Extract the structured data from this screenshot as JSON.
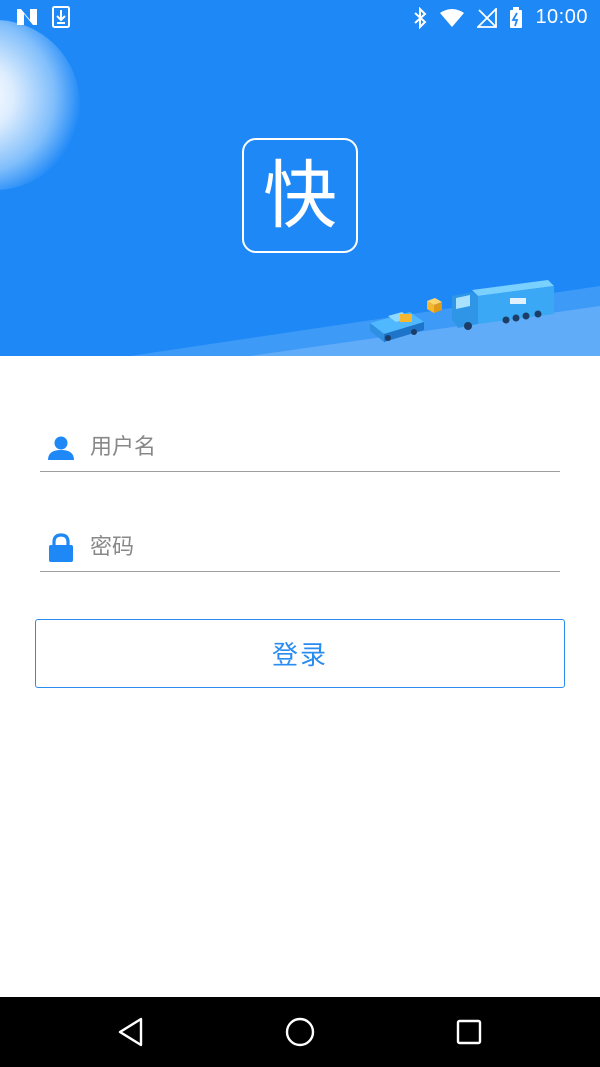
{
  "status_bar": {
    "time": "10:00",
    "icons": [
      "n-icon",
      "download-icon",
      "bluetooth-icon",
      "wifi-icon",
      "no-signal-icon",
      "battery-icon"
    ]
  },
  "header": {
    "logo_text": "快",
    "background_color": "#1e88f7"
  },
  "form": {
    "username_placeholder": "用户名",
    "password_placeholder": "密码",
    "login_label": "登录",
    "accent_color": "#2a8cf0"
  },
  "nav_bar": {
    "icons": [
      "back-icon",
      "home-icon",
      "recents-icon"
    ]
  }
}
